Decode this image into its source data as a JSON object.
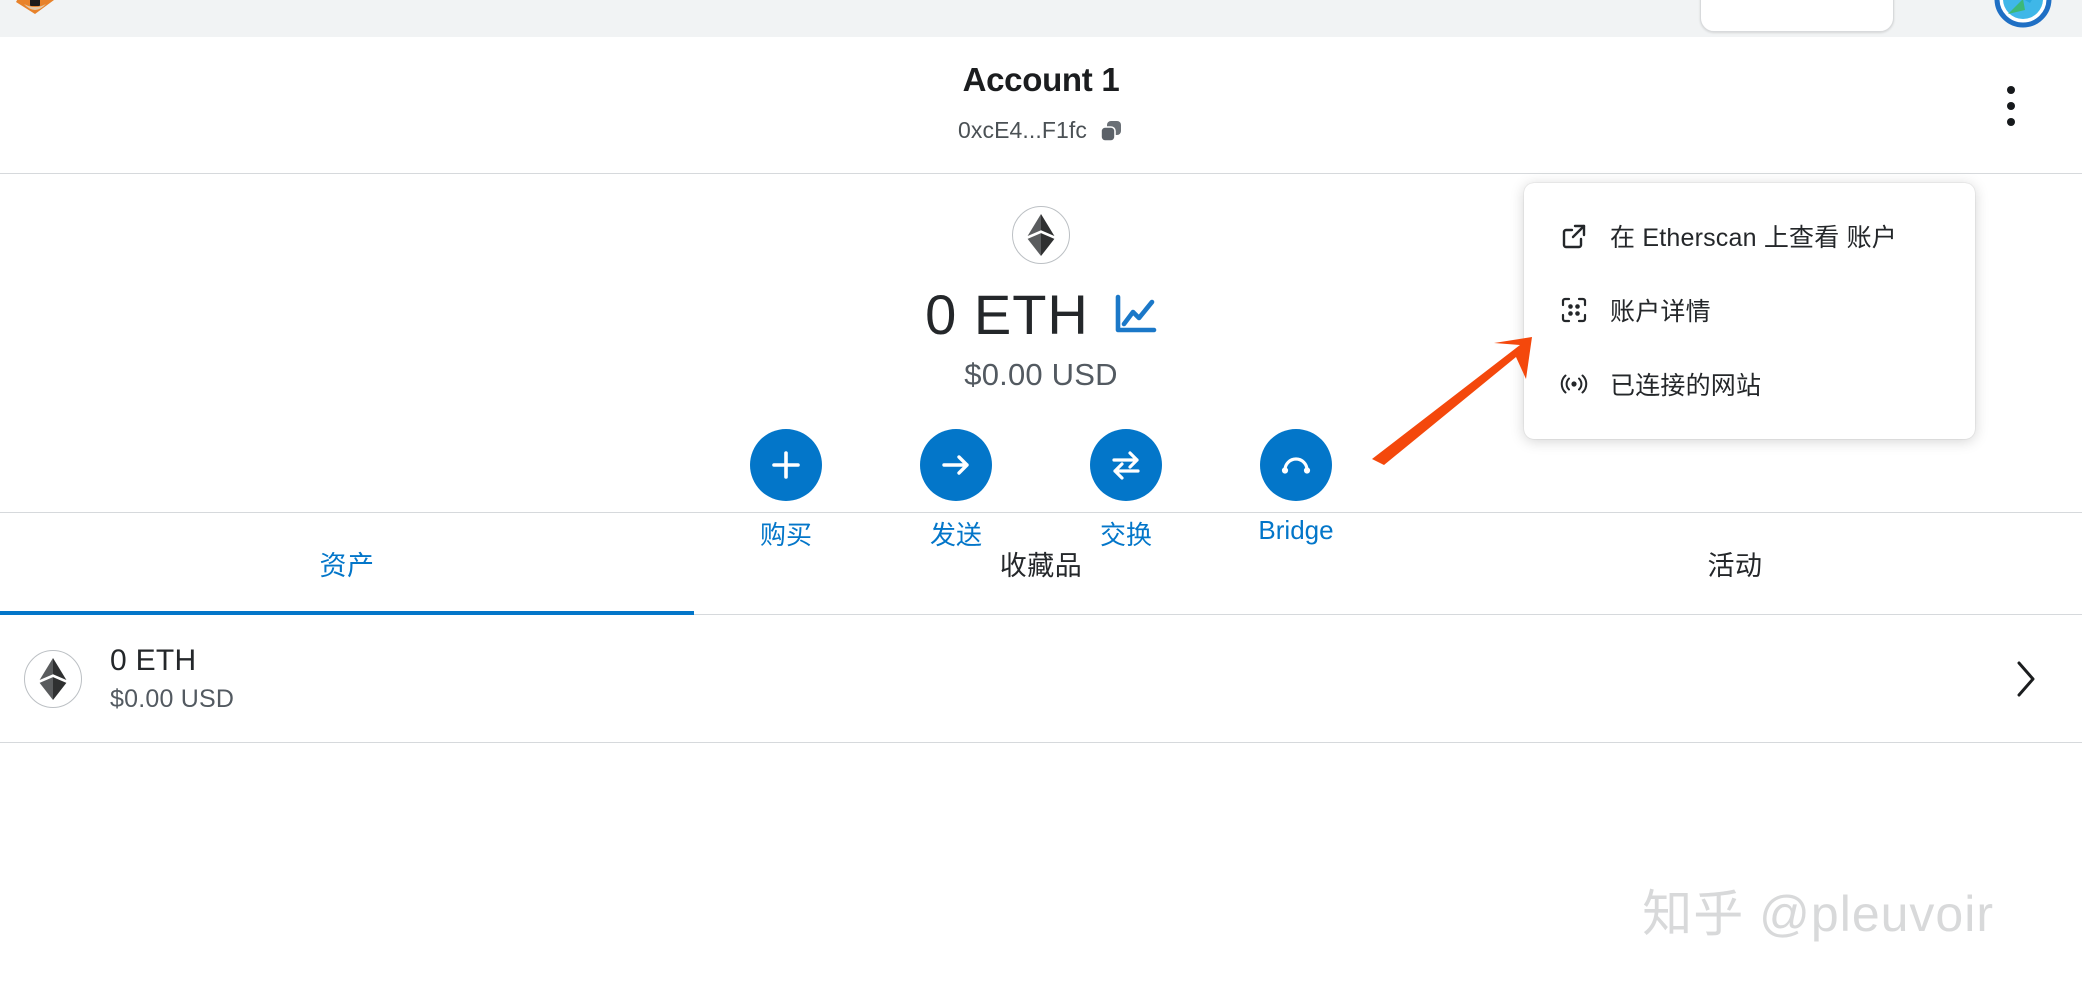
{
  "browser": {
    "firefox_icon": "firefox-icon",
    "safari_icon": "safari-compass-icon",
    "omnibox_value": ""
  },
  "colors": {
    "accent_blue": "#0376c9",
    "chart_blue": "#1b78c8",
    "annotation_orange": "#f4480c",
    "text_primary": "#24272a",
    "text_secondary": "#535a61",
    "border": "#d6d9dc"
  },
  "header": {
    "account_name": "Account 1",
    "address": "0xcE4...F1fc",
    "copy_icon": "copy-icon",
    "kebab_icon": "more-vertical-icon"
  },
  "account_menu": {
    "items": [
      {
        "label": "在 Etherscan 上查看 账户",
        "icon": "external-link-icon"
      },
      {
        "label": "账户详情",
        "icon": "qr-scan-icon"
      },
      {
        "label": "已连接的网站",
        "icon": "broadcast-icon"
      }
    ]
  },
  "balance": {
    "token_icon": "ethereum-icon",
    "amount": "0 ETH",
    "fiat": "$0.00 USD",
    "chart_icon": "line-chart-icon"
  },
  "actions": [
    {
      "label": "购买",
      "icon": "plus-icon"
    },
    {
      "label": "发送",
      "icon": "arrow-right-icon"
    },
    {
      "label": "交换",
      "icon": "swap-icon"
    },
    {
      "label": "Bridge",
      "icon": "bridge-arc-icon"
    }
  ],
  "tabs": [
    {
      "label": "资产",
      "active": true
    },
    {
      "label": "收藏品",
      "active": false
    },
    {
      "label": "活动",
      "active": false
    }
  ],
  "assets": [
    {
      "icon": "ethereum-icon",
      "amount": "0 ETH",
      "fiat": "$0.00 USD",
      "chevron": "chevron-right-icon"
    }
  ],
  "watermark": {
    "text": "知乎 @pleuvoir"
  },
  "annotation": {
    "type": "arrow",
    "points_to": "账户详情",
    "color": "#f4480c"
  }
}
